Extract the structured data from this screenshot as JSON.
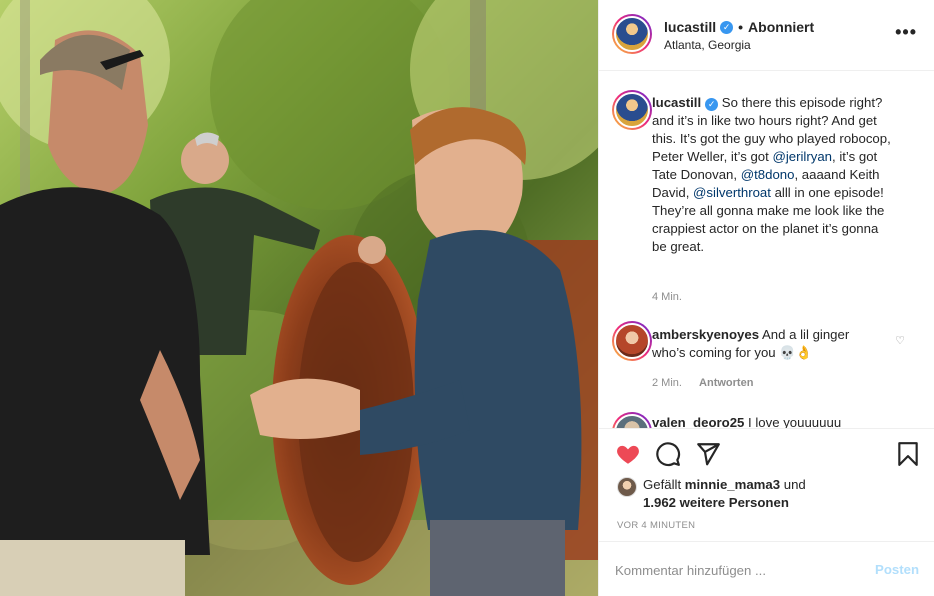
{
  "post": {
    "username": "lucastill",
    "follow_status": "Abonniert",
    "location": "Atlanta, Georgia",
    "more_icon": "more-options-icon"
  },
  "caption": {
    "username": "lucastill",
    "part1": "So there this episode right? and it’s in like two hours right? And get this. It’s got the guy who played robocop, Peter Weller, it’s got ",
    "mention1": "@jerilryan",
    "part2": ", it’s got Tate Donovan, ",
    "mention2": "@t8dono",
    "part3": ", aaaand Keith David, ",
    "mention3": "@silverthroat",
    "part4": " alll in one episode! They’re all gonna make me look like the crappiest actor on the planet it’s gonna be great.",
    "time": "4 Min."
  },
  "comments": [
    {
      "username": "amberskyenoyes",
      "text": "And a lil ginger who’s coming for you 💀👌",
      "time": "2 Min.",
      "reply_label": "Antworten"
    },
    {
      "username": "valen_deoro25",
      "text": "I love youuuuuu"
    }
  ],
  "actions": {
    "like_icon": "heart-filled-icon",
    "comment_icon": "comment-icon",
    "share_icon": "share-icon",
    "save_icon": "bookmark-icon",
    "like_color": "#ed4956"
  },
  "likes": {
    "prefix": "Gefällt ",
    "user": "minnie_mama3",
    "connector": " und",
    "count_text": "1.962 weitere Personen"
  },
  "timestamp": "VOR 4 MINUTEN",
  "add_comment": {
    "placeholder": "Kommentar hinzufügen ...",
    "post_label": "Posten"
  }
}
